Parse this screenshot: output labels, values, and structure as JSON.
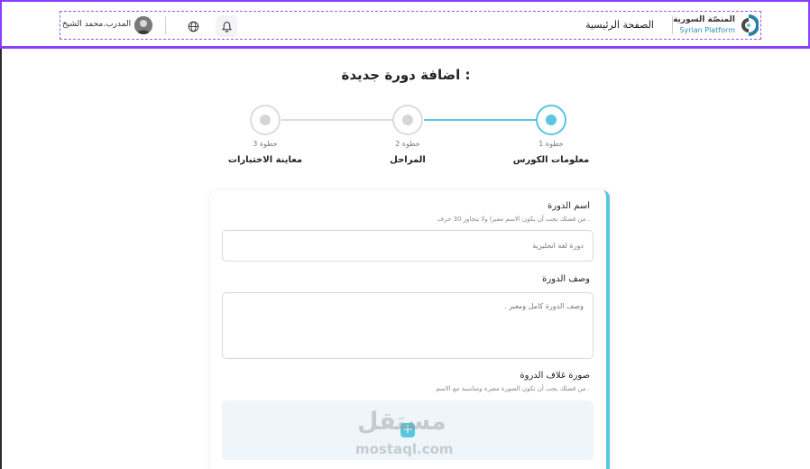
{
  "header": {
    "logo_ar": "المنصّة السورية",
    "logo_en": "Syrian Platform",
    "home_label": "الصفحة الرئيسية",
    "user_name": "المدرب.محمد الشيخ"
  },
  "page": {
    "title": "اضافة دورة جديدة :"
  },
  "steps": [
    {
      "small": "خطوة 1",
      "name": "معلومات الكورس",
      "active": true
    },
    {
      "small": "خطوة 2",
      "name": "المراحل",
      "active": false
    },
    {
      "small": "خطوة 3",
      "name": "معاينة الاختبارات",
      "active": false
    }
  ],
  "form": {
    "course_name_label": "اسم الدورة",
    "course_name_hint": "من فضلك يجب أن يكون الاسم معبرا ولا يتجاوز 30 حرف .",
    "course_name_placeholder": "دورة لغة انجليزية",
    "description_label": "وصف الدورة",
    "description_placeholder": "وصف الدورة كامل ومعبر .",
    "cover_label": "صورة غلاف الدروة",
    "cover_hint": "من فضلك يجب أن تكون الصورة معبرة ومناسبة مع الاسم .",
    "upload_symbol": "+"
  },
  "watermark": {
    "arabic": "مستقل",
    "latin": "mostaql.com"
  },
  "colors": {
    "accent": "#59c6e0",
    "frame": "#8b3dff"
  }
}
